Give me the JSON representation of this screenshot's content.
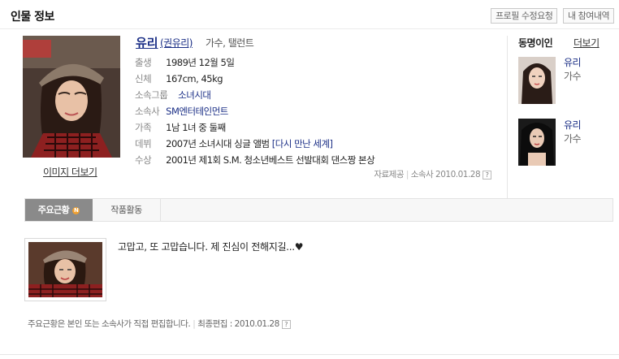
{
  "header": {
    "title": "인물 정보",
    "buttons": {
      "edit_request": "프로필 수정요청",
      "my_history": "내 참여내역"
    }
  },
  "profile": {
    "name": "유리",
    "real_name": "(권유리)",
    "job": "가수, 탤런트",
    "image_more": "이미지 더보기",
    "fields": [
      {
        "key": "출생",
        "value": "1989년 12월 5일"
      },
      {
        "key": "신체",
        "value": "167cm, 45kg"
      },
      {
        "key": "소속그룹",
        "value": "소녀시대"
      },
      {
        "key": "소속사",
        "value": "SM엔터테인먼트"
      },
      {
        "key": "가족",
        "value": "1남 1녀 중 둘째"
      },
      {
        "key": "데뷔",
        "value": "2007년 소녀시대 싱글 앨범",
        "link": "[다시 만난 세계]"
      },
      {
        "key": "수상",
        "value": "2001년 제1회 S.M. 청소년베스트 선발대회 댄스짱 본상"
      }
    ],
    "source_label": "자료제공",
    "source_value": "소속사 2010.01.28",
    "help": "?"
  },
  "same_name": {
    "title": "동명이인",
    "more": "더보기",
    "people": [
      {
        "name": "유리",
        "job": "가수"
      },
      {
        "name": "유리",
        "job": "가수"
      }
    ]
  },
  "tabs": {
    "news": "주요근황",
    "news_badge": "N",
    "works": "작품활동"
  },
  "news": {
    "text": "고맙고, 또 고맙습니다. 제 진심이 전해지길...♥",
    "footnote": "주요근황은 본인 또는 소속사가 직접 편집합니다.",
    "last_edit_label": "최종편집 : 2010.01.28",
    "help": "?"
  },
  "colors": {
    "link_blue": "#1b2f86",
    "tab_active": "#8a8a8a",
    "badge": "#f0a030"
  }
}
